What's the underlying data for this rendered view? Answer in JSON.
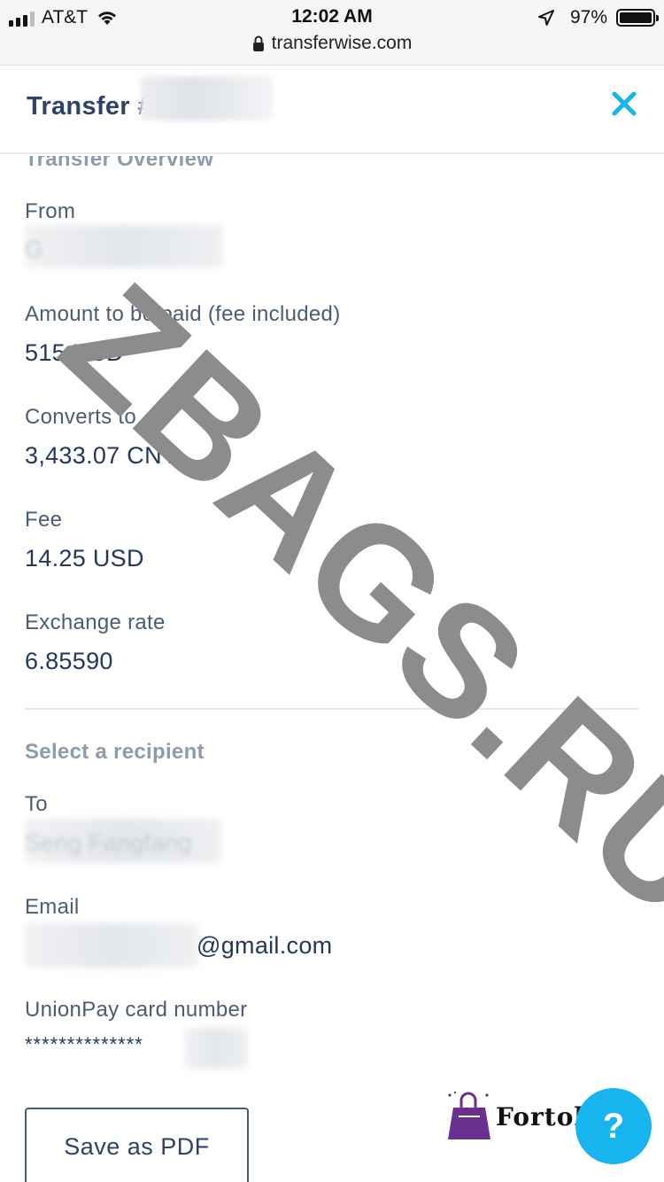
{
  "status_bar": {
    "carrier": "AT&T",
    "time": "12:02 AM",
    "url": "transferwise.com",
    "battery": "97%"
  },
  "modal": {
    "title": "Transfer #",
    "close_icon": "close-icon"
  },
  "overview": {
    "heading": "Transfer Overview",
    "from_label": "From",
    "from_value": "G",
    "amount_label": "Amount to be paid (fee included)",
    "amount_value": "515 USD",
    "converts_label": "Converts to",
    "converts_value": "3,433.07 CNY",
    "fee_label": "Fee",
    "fee_value": "14.25 USD",
    "rate_label": "Exchange rate",
    "rate_value": "6.85590"
  },
  "recipient": {
    "heading": "Select a recipient",
    "to_label": "To",
    "to_value": "Seng Fangfang",
    "email_label": "Email",
    "email_value_suffix": "@gmail.com",
    "card_label": "UnionPay card number",
    "card_value": "**************"
  },
  "actions": {
    "save_pdf": "Save as PDF",
    "help": "?"
  },
  "watermarks": {
    "diagonal": "ZBAGS.RU",
    "logo": "Fortok.ru"
  },
  "colors": {
    "accent": "#18b4ef",
    "text_dark": "#24385b",
    "text_label": "#4a5d73",
    "heading_muted": "#8d9bab",
    "watermark": "#8c8c8c"
  }
}
